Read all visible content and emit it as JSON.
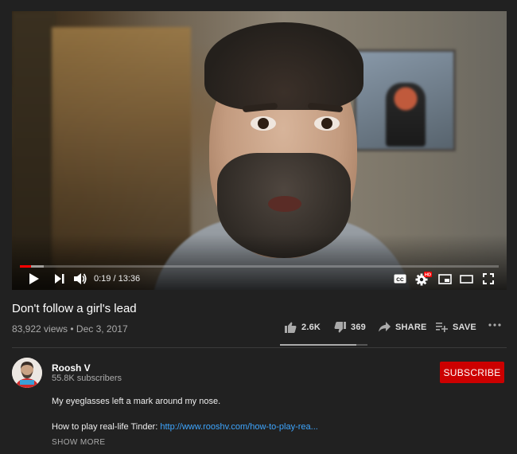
{
  "player": {
    "current_time": "0:19",
    "duration": "13:36",
    "time_display": "0:19 / 13:36",
    "played_fraction": 0.023,
    "buffered_fraction": 0.05,
    "progress_color": "#ff0000",
    "controls": {
      "play": "play-icon",
      "next": "next-icon",
      "volume": "volume-icon",
      "captions": "CC",
      "settings": "gear-icon",
      "settings_badge": "HD",
      "miniplayer": "miniplayer-icon",
      "theater": "theater-icon",
      "fullscreen": "fullscreen-icon"
    }
  },
  "video": {
    "title": "Don't follow a girl's lead",
    "meta": "83,922 views • Dec 3, 2017"
  },
  "actions": {
    "likes": "2.6K",
    "dislikes": "369",
    "share": "SHARE",
    "save": "SAVE",
    "like_ratio": 0.876
  },
  "channel": {
    "name": "Roosh V",
    "subscribers": "55.8K subscribers",
    "subscribe_label": "SUBSCRIBE",
    "subscribe_color": "#cc0000"
  },
  "description": {
    "line1": "My eyeglasses left a mark around my nose.",
    "line2_prefix": "How to play real-life Tinder: ",
    "line2_link": "http://www.rooshv.com/how-to-play-rea...",
    "show_more": "SHOW MORE"
  }
}
